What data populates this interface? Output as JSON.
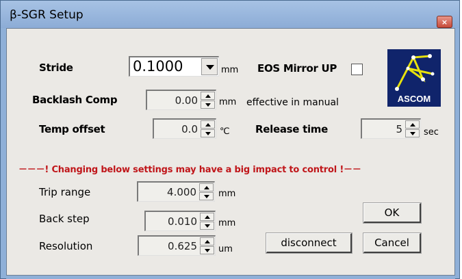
{
  "window": {
    "title": "β-SGR Setup",
    "close_glyph": "×"
  },
  "stride": {
    "label": "Stride",
    "value": "0.1000",
    "unit": "mm"
  },
  "eos_mirror_up": {
    "label": "EOS Mirror UP",
    "checked": false
  },
  "logo": {
    "text": "ASCOM"
  },
  "backlash": {
    "label": "Backlash Comp",
    "value": "0.00",
    "unit": "mm",
    "note": "effective in manual"
  },
  "temp_offset": {
    "label": "Temp offset",
    "value": "0.0",
    "unit": "℃"
  },
  "release_time": {
    "label": "Release time",
    "value": "5",
    "unit": "sec"
  },
  "warning": {
    "text": "－－－! Changing below settings may have a big impact to control !－－",
    "color": "#c0161a"
  },
  "trip_range": {
    "label": "Trip range",
    "value": "4.000",
    "unit": "mm"
  },
  "back_step": {
    "label": "Back step",
    "value": "0.010",
    "unit": "mm"
  },
  "resolution": {
    "label": "Resolution",
    "value": "0.625",
    "unit": "um"
  },
  "buttons": {
    "ok": "OK",
    "disconnect": "disconnect",
    "cancel": "Cancel"
  }
}
